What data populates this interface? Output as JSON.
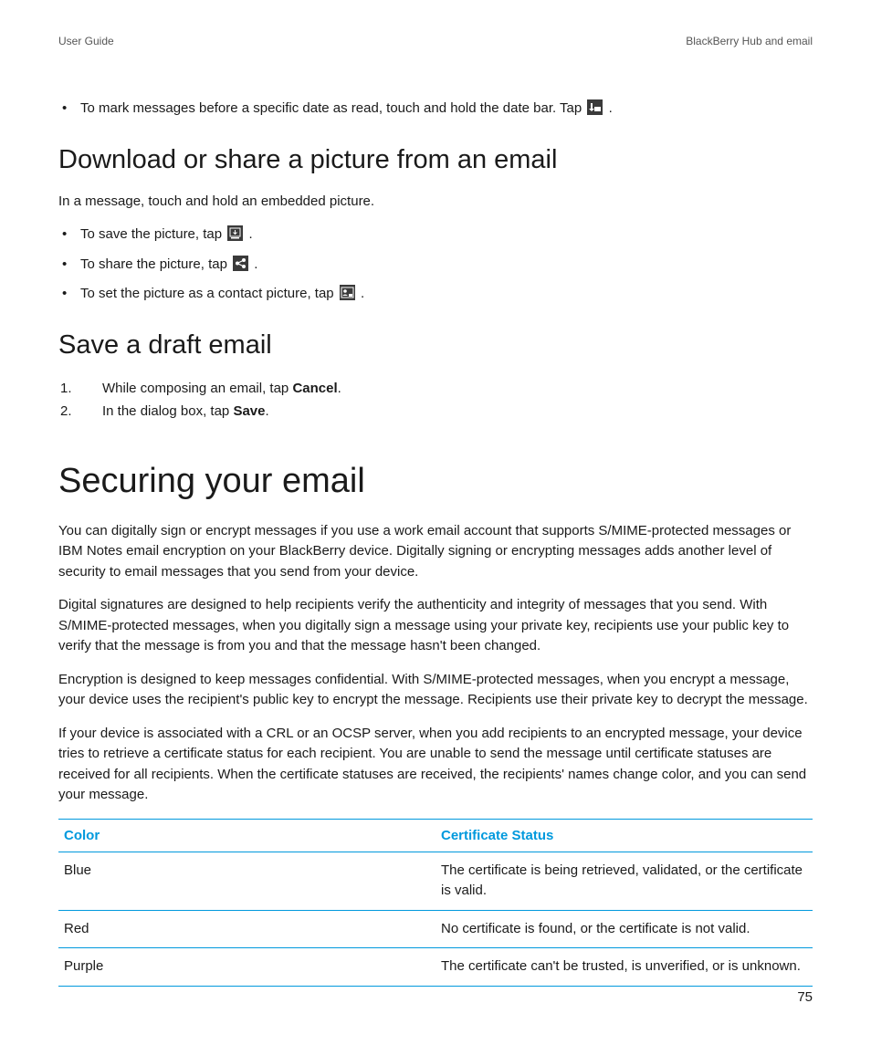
{
  "header": {
    "left": "User Guide",
    "right": "BlackBerry Hub and email"
  },
  "intro_bullet": {
    "before": "To mark messages before a specific date as read, touch and hold the date bar. Tap ",
    "after": "."
  },
  "section_download": {
    "heading": "Download or share a picture from an email",
    "lead": "In a message, touch and hold an embedded picture.",
    "items": [
      {
        "before": "To save the picture, tap ",
        "after": ".",
        "icon": "save-image-icon"
      },
      {
        "before": "To share the picture, tap ",
        "after": ".",
        "icon": "share-icon"
      },
      {
        "before": "To set the picture as a contact picture, tap ",
        "after": ".",
        "icon": "contact-picture-icon"
      }
    ]
  },
  "section_draft": {
    "heading": "Save a draft email",
    "steps": [
      {
        "pre": "While composing an email, tap ",
        "bold": "Cancel",
        "post": "."
      },
      {
        "pre": "In the dialog box, tap ",
        "bold": "Save",
        "post": "."
      }
    ]
  },
  "section_secure": {
    "heading": "Securing your email",
    "paras": [
      "You can digitally sign or encrypt messages if you use a work email account that supports S/MIME-protected messages or IBM Notes email encryption on your BlackBerry device. Digitally signing or encrypting messages adds another level of security to email messages that you send from your device.",
      "Digital signatures are designed to help recipients verify the authenticity and integrity of messages that you send. With S/MIME-protected messages, when you digitally sign a message using your private key, recipients use your public key to verify that the message is from you and that the message hasn't been changed.",
      "Encryption is designed to keep messages confidential. With S/MIME-protected messages, when you encrypt a message, your device uses the recipient's public key to encrypt the message. Recipients use their private key to decrypt the message.",
      "If your device is associated with a CRL or an OCSP server, when you add recipients to an encrypted message, your device tries to retrieve a certificate status for each recipient. You are unable to send the message until certificate statuses are received for all recipients. When the certificate statuses are received, the recipients' names change color, and you can send your message."
    ],
    "table": {
      "headers": [
        "Color",
        "Certificate Status"
      ],
      "rows": [
        [
          "Blue",
          "The certificate is being retrieved, validated, or the certificate is valid."
        ],
        [
          "Red",
          "No certificate is found, or the certificate is not valid."
        ],
        [
          "Purple",
          "The certificate can't be trusted, is unverified, or is unknown."
        ]
      ]
    }
  },
  "page_number": "75"
}
